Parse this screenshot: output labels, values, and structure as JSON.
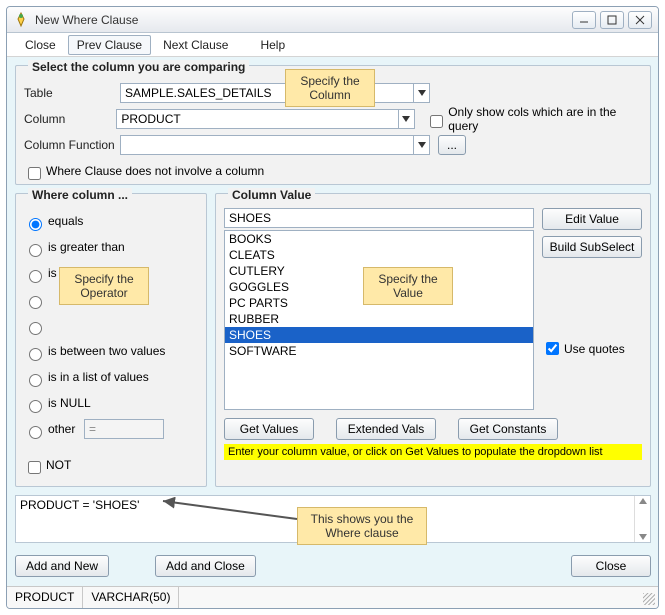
{
  "window": {
    "title": "New Where Clause"
  },
  "menu": {
    "close": "Close",
    "prev": "Prev Clause",
    "next": "Next Clause",
    "help": "Help"
  },
  "top": {
    "title": "Select the column you are comparing",
    "table_lbl": "Table",
    "table_val": "SAMPLE.SALES_DETAILS",
    "column_lbl": "Column",
    "column_val": "PRODUCT",
    "only_show": "Only show cols which are in the query",
    "func_lbl": "Column Function",
    "func_val": "",
    "no_col": "Where Clause does not involve a column",
    "func_btn": "..."
  },
  "where": {
    "title": "Where column ...",
    "o0": "equals",
    "o1": "is greater than",
    "o2": "is less than",
    "o3placeholder": "",
    "o4placeholder": "",
    "o5": "is between two values",
    "o6": "is in a list of values",
    "o7": "is NULL",
    "o8": "other",
    "o8sel": "=",
    "not": "NOT"
  },
  "colval": {
    "title": "Column Value",
    "input": "SHOES",
    "l0": "BOOKS",
    "l1": "CLEATS",
    "l2": "CUTLERY",
    "l3": "GOGGLES",
    "l4": "PC PARTS",
    "l5": "RUBBER",
    "l6": "SHOES",
    "l7": "SOFTWARE",
    "edit": "Edit Value",
    "build": "Build SubSelect",
    "useq": "Use quotes",
    "getv": "Get Values",
    "ext": "Extended Vals",
    "getc": "Get Constants",
    "hint": "Enter your column value, or click on Get Values to populate the dropdown list"
  },
  "clause": {
    "text": "PRODUCT = 'SHOES'"
  },
  "buttons": {
    "addnew": "Add and New",
    "addclose": "Add and Close",
    "close": "Close"
  },
  "status": {
    "c0": "PRODUCT",
    "c1": "VARCHAR(50)"
  },
  "callouts": {
    "col": "Specify the\nColumn",
    "op": "Specify the\nOperator",
    "val": "Specify the\nValue",
    "clause": "This shows you the\nWhere clause"
  }
}
